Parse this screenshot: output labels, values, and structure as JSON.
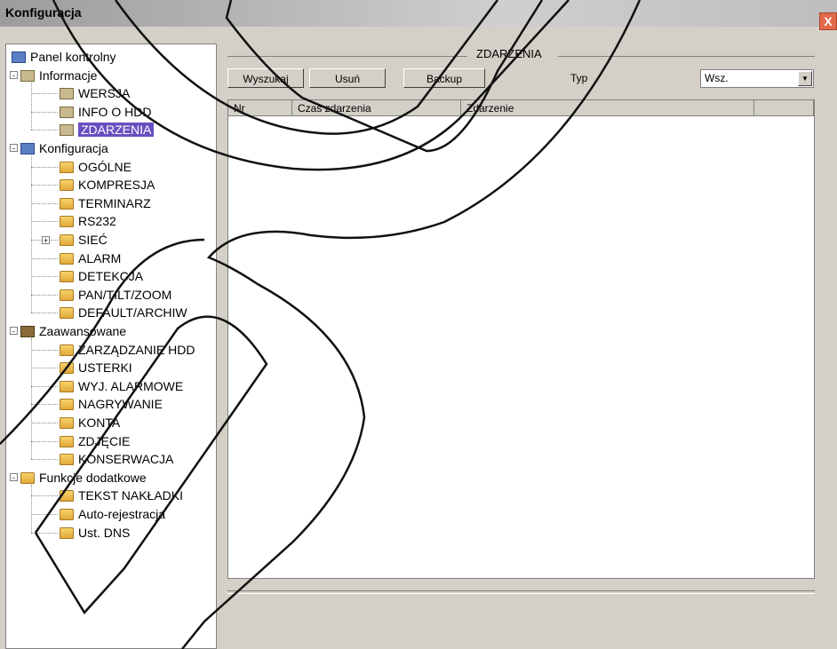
{
  "window": {
    "title": "Konfiguracja",
    "close_glyph": "X"
  },
  "tree": {
    "root": "Panel kontrolny",
    "groups": [
      {
        "label": "Informacje",
        "expander": "-",
        "children": [
          "WERSJA",
          "INFO O HDD",
          "ZDARZENIA"
        ]
      },
      {
        "label": "Konfiguracja",
        "expander": "-",
        "children": [
          "OGÓLNE",
          "KOMPRESJA",
          "TERMINARZ",
          "RS232",
          "SIEĆ",
          "ALARM",
          "DETEKCJA",
          "PAN/TILT/ZOOM",
          "DEFAULT/ARCHIW"
        ]
      },
      {
        "label": "Zaawansowane",
        "expander": "-",
        "children": [
          "ZARZĄDZANIE HDD",
          "USTERKI",
          "WYJ. ALARMOWE",
          "NAGRYWANIE",
          "KONTA",
          "ZDJĘCIE",
          "KONSERWACJA"
        ]
      },
      {
        "label": "Funkcje dodatkowe",
        "expander": "-",
        "children": [
          "TEKST NAKŁADKI",
          "Auto-rejestracja",
          "Ust. DNS"
        ]
      }
    ],
    "selected": "ZDARZENIA",
    "sub_expander": "+"
  },
  "events": {
    "group_title": "ZDARZENIA",
    "search_label": "Wyszukaj",
    "delete_label": "Usuń",
    "backup_label": "Backup",
    "type_label": "Typ",
    "type_value": "Wsz.",
    "type_arrow": "▼",
    "columns": [
      "Nr",
      "Czas zdarzenia",
      "Zdarzenie",
      ""
    ]
  },
  "colors": {
    "selection": "#6a4fc0",
    "folder": "#e8b44a",
    "close": "#e06a4a"
  }
}
